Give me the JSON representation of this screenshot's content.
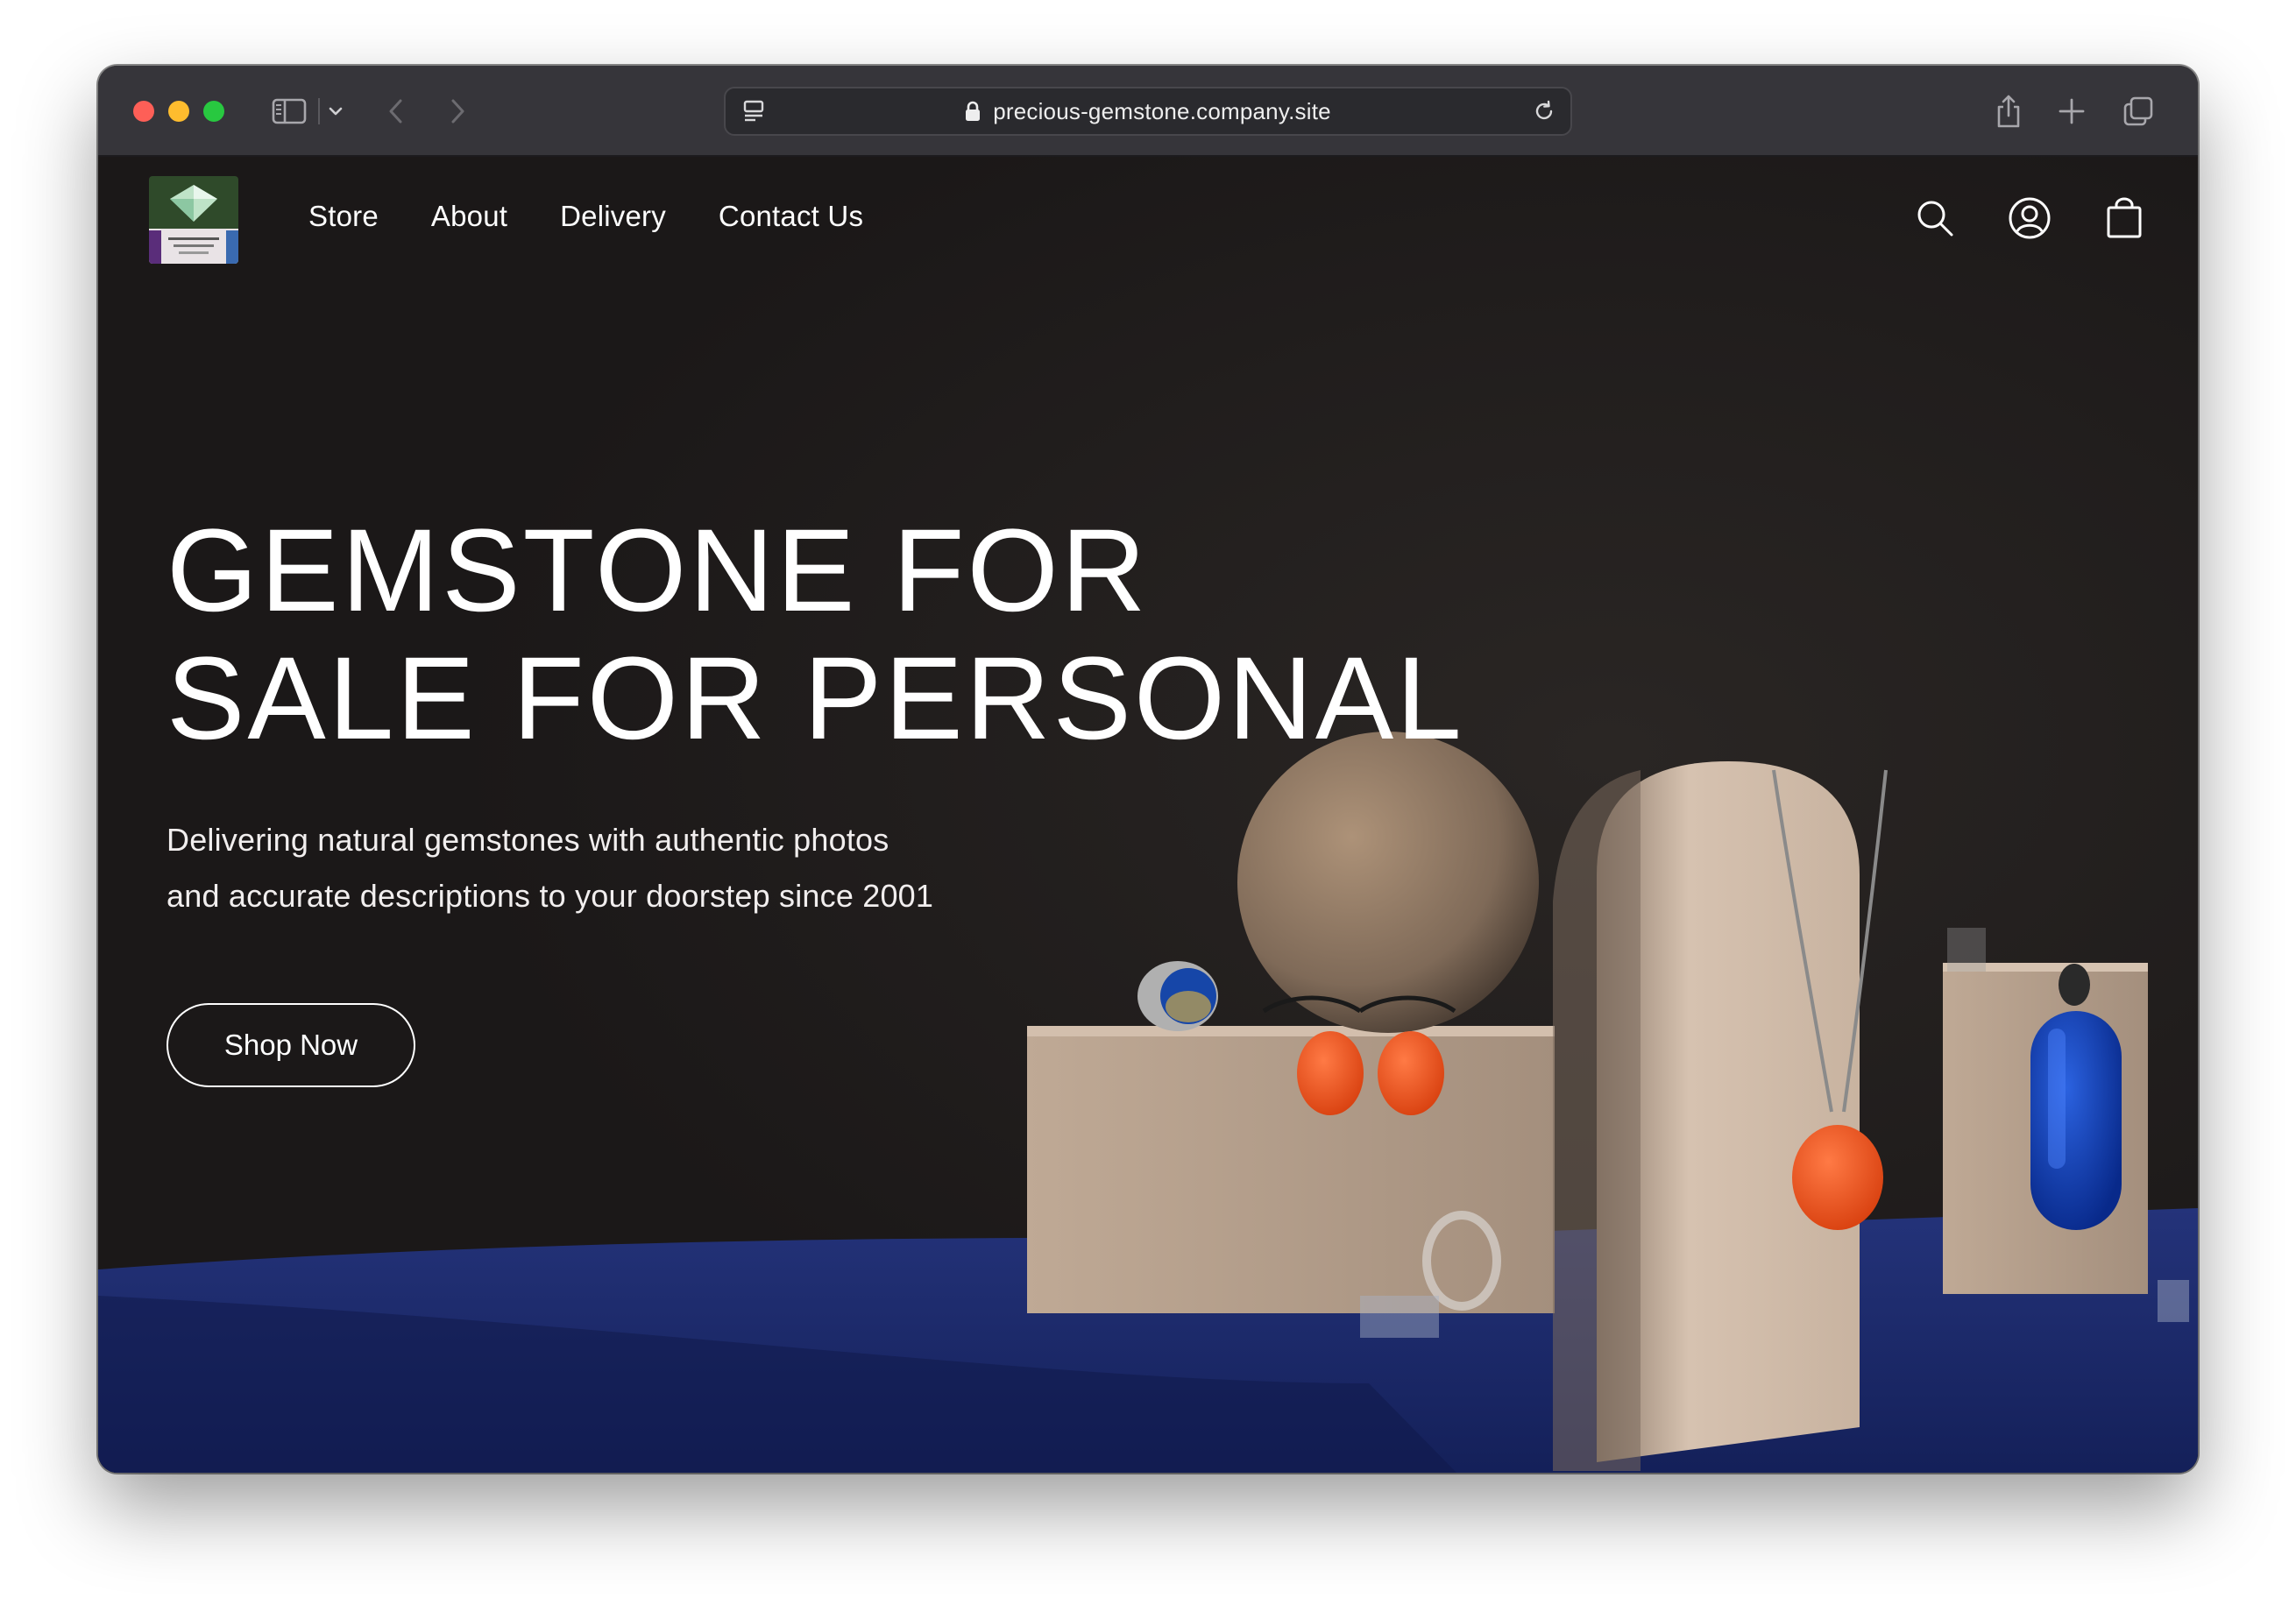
{
  "browser": {
    "url": "precious-gemstone.company.site",
    "icons": [
      "sidebar-toggle-icon",
      "chevron-down-icon",
      "back-arrow-icon",
      "forward-arrow-icon",
      "site-settings-icon",
      "lock-icon",
      "reload-icon",
      "share-icon",
      "new-tab-icon",
      "tab-overview-icon"
    ]
  },
  "site": {
    "nav": {
      "links": [
        "Store",
        "About",
        "Delivery",
        "Contact Us"
      ],
      "icons": [
        "search-icon",
        "account-icon",
        "cart-icon"
      ]
    },
    "hero": {
      "title_lines": [
        "GEMSTONE FOR",
        "SALE FOR PERSONAL"
      ],
      "subtitle_lines": [
        "Delivering natural gemstones with authentic photos",
        "and accurate descriptions to your doorstep since 2001"
      ],
      "cta_label": "Shop Now"
    }
  },
  "colors": {
    "toolbar": "#36353a",
    "hero_background": "#1d1a1a",
    "table_blue": "#1c2f78",
    "pedestal": "#cdb6a4",
    "accent_orange": "#f2501e",
    "accent_blue": "#0b3aa8"
  }
}
